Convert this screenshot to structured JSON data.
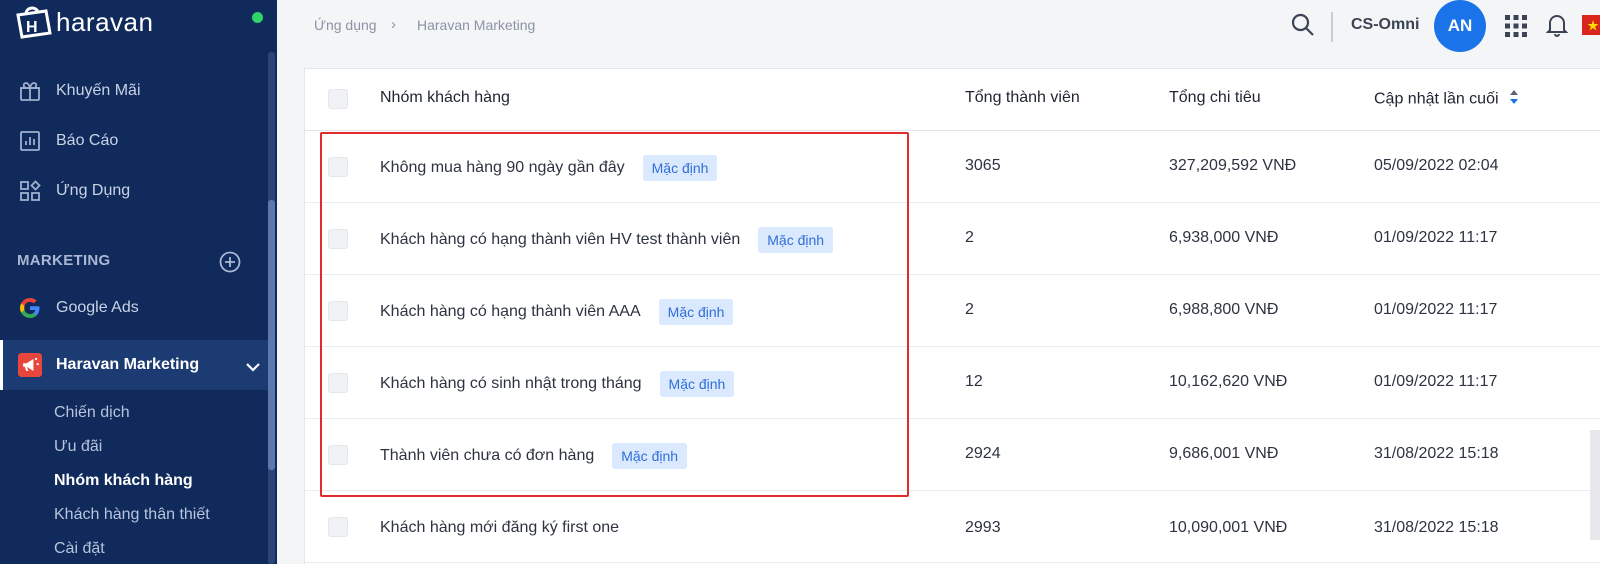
{
  "app": {
    "logo_text": "haravan"
  },
  "sidebar": {
    "items": [
      {
        "label": "Khuyến Mãi",
        "icon": "gift-icon"
      },
      {
        "label": "Báo Cáo",
        "icon": "report-chart-icon"
      },
      {
        "label": "Ứng Dụng",
        "icon": "apps-grid-icon"
      }
    ],
    "section_title": "MARKETING",
    "channels": [
      {
        "label": "Google Ads",
        "icon": "google-icon"
      },
      {
        "label": "Haravan Marketing",
        "icon": "megaphone-icon"
      }
    ],
    "sub_items": [
      {
        "label": "Chiến dịch"
      },
      {
        "label": "Ưu đãi"
      },
      {
        "label": "Nhóm khách hàng"
      },
      {
        "label": "Khách hàng thân thiết"
      },
      {
        "label": "Cài đặt"
      }
    ]
  },
  "breadcrumb": {
    "root": "Ứng dụng",
    "sep": "›",
    "current": "Haravan Marketing"
  },
  "topbar": {
    "store_name": "CS-Omni",
    "avatar_initials": "AN"
  },
  "table": {
    "headers": {
      "name": "Nhóm khách hàng",
      "members": "Tổng thành viên",
      "spend": "Tổng chi tiêu",
      "updated": "Cập nhật lần cuối"
    },
    "rows": [
      {
        "name": "Không mua hàng 90 ngày gần đây",
        "badge": "Mặc định",
        "members": "3065",
        "spend": "327,209,592 VNĐ",
        "updated": "05/09/2022 02:04"
      },
      {
        "name": "Khách hàng có hạng thành viên HV test thành viên",
        "badge": "Mặc định",
        "members": "2",
        "spend": "6,938,000 VNĐ",
        "updated": "01/09/2022 11:17"
      },
      {
        "name": "Khách hàng có hạng thành viên AAA",
        "badge": "Mặc định",
        "members": "2",
        "spend": "6,988,800 VNĐ",
        "updated": "01/09/2022 11:17"
      },
      {
        "name": "Khách hàng có sinh nhật trong tháng",
        "badge": "Mặc định",
        "members": "12",
        "spend": "10,162,620 VNĐ",
        "updated": "01/09/2022 11:17"
      },
      {
        "name": "Thành viên chưa có đơn hàng",
        "badge": "Mặc định",
        "members": "2924",
        "spend": "9,686,001 VNĐ",
        "updated": "31/08/2022 15:18"
      },
      {
        "name": "Khách hàng mới đăng ký first one",
        "badge": "",
        "members": "2993",
        "spend": "10,090,001 VNĐ",
        "updated": "31/08/2022 15:18"
      }
    ]
  }
}
